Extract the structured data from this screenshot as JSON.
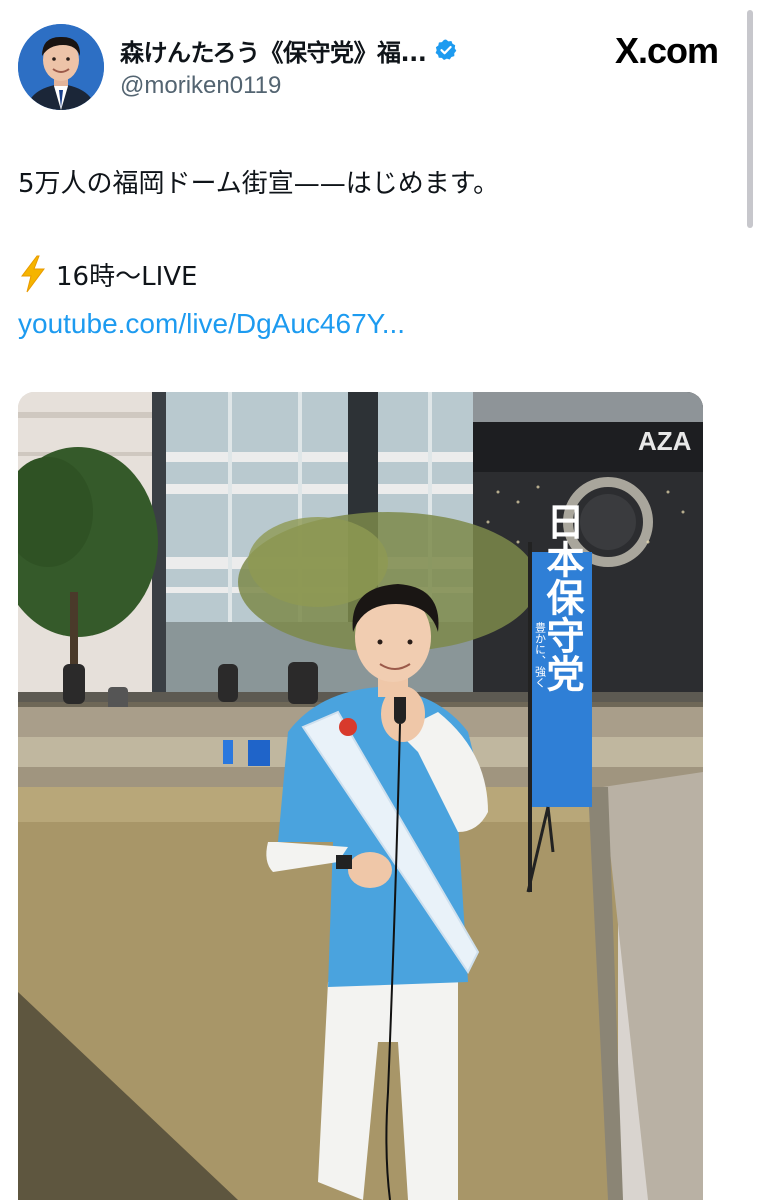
{
  "post": {
    "display_name": "森けんたろう《保守党》福...",
    "handle": "@moriken0119",
    "verified": true,
    "site": "X.com",
    "text_line1": "5万人の福岡ドーム街宣——はじめます。",
    "text_line2": "16時〜LIVE",
    "link": "youtube.com/live/DgAuc467Y...",
    "media": {
      "banner_text": "日本保守党",
      "banner_subtext": "豊かに、強く",
      "sign_text": "AZA"
    }
  },
  "icons": [
    "avatar",
    "verified-badge-icon",
    "lightning-icon",
    "x-logo-icon"
  ],
  "colors": {
    "link": "#1d9bf0",
    "verified": "#1d9bf0",
    "handle": "#536471",
    "shirt": "#4aa3de",
    "banner": "#2f7fd6"
  }
}
